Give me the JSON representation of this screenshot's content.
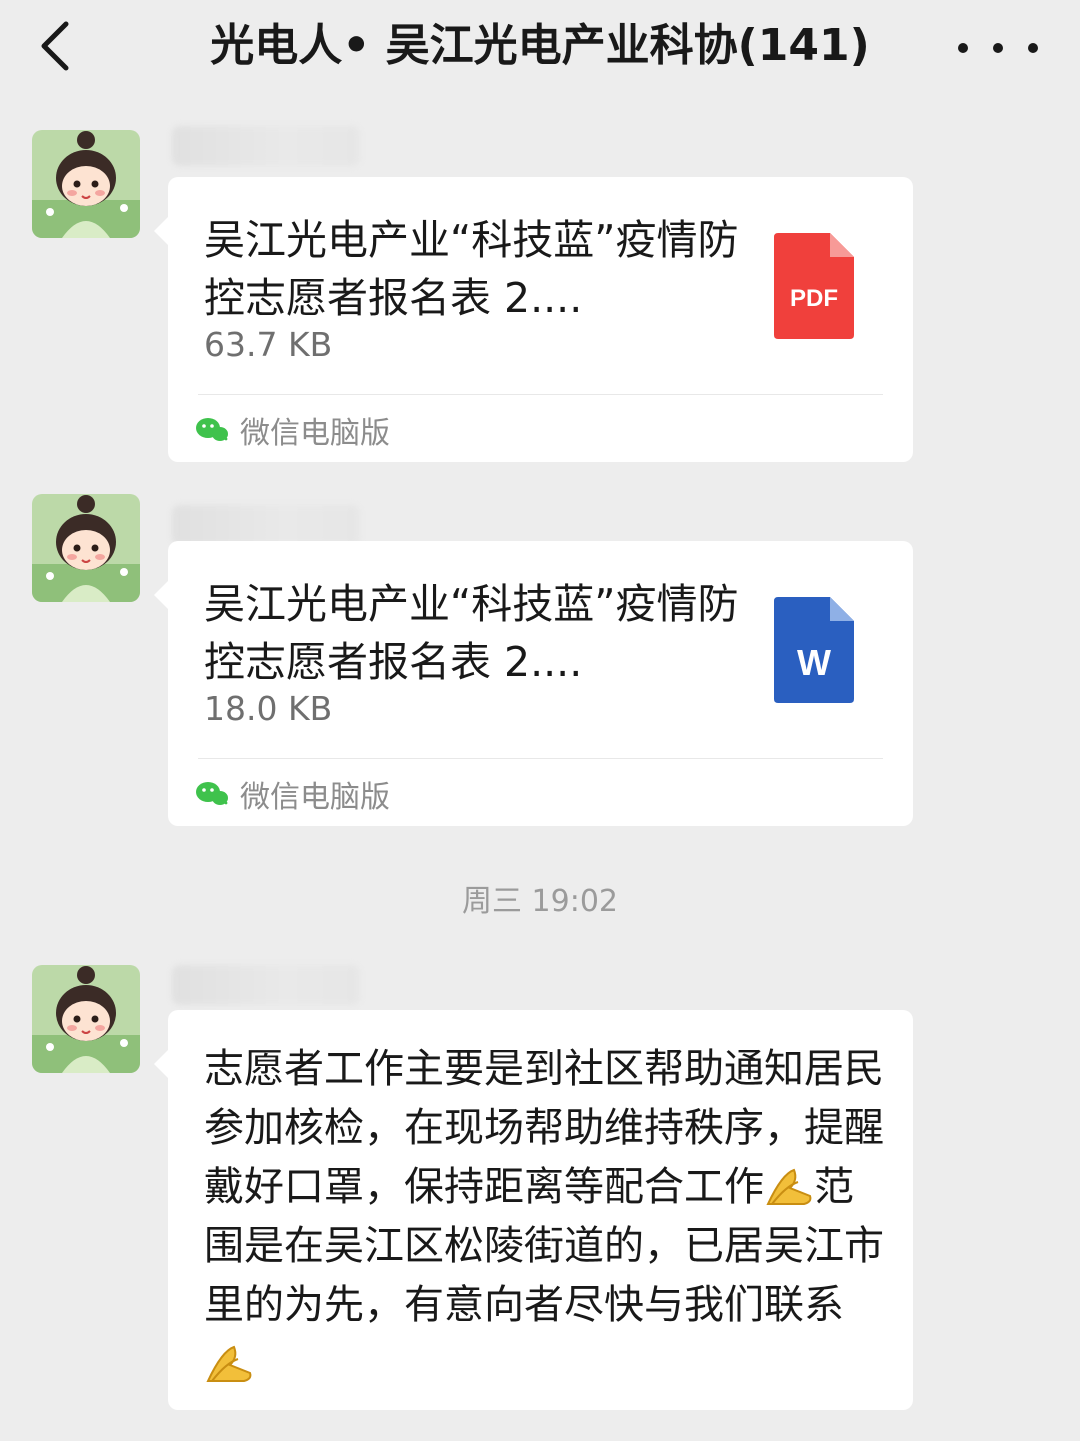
{
  "header": {
    "back_icon": "chevron-left-icon",
    "title": "光电人• 吴江光电产业科协(141)",
    "more_icon": "more-dots-icon"
  },
  "messages": [
    {
      "type": "file",
      "file_name": "吴江光电产业“科技蓝”疫情防控志愿者报名表 2....",
      "file_size": "63.7 KB",
      "file_type": "PDF",
      "icon": "pdf-file-icon",
      "icon_color": "#f0403c",
      "source": "微信电脑版",
      "source_icon": "wechat-icon"
    },
    {
      "type": "file",
      "file_name": "吴江光电产业“科技蓝”疫情防控志愿者报名表 2....",
      "file_size": "18.0 KB",
      "file_type": "W",
      "icon": "word-file-icon",
      "icon_color": "#2a5fc0",
      "source": "微信电脑版",
      "source_icon": "wechat-icon"
    }
  ],
  "timestamp": "周三 19:02",
  "text_message": {
    "part1": "志愿者工作主要是到社区帮助通知居民参加核检，在现场帮助维持秩序，提醒戴好口罩，保持距离等配合工作",
    "part2": "范围是在吴江区松陵街道的，已居吴江市里的为先，有意向者尽快与我们联系",
    "emoji": "folded-hands-emoji"
  }
}
